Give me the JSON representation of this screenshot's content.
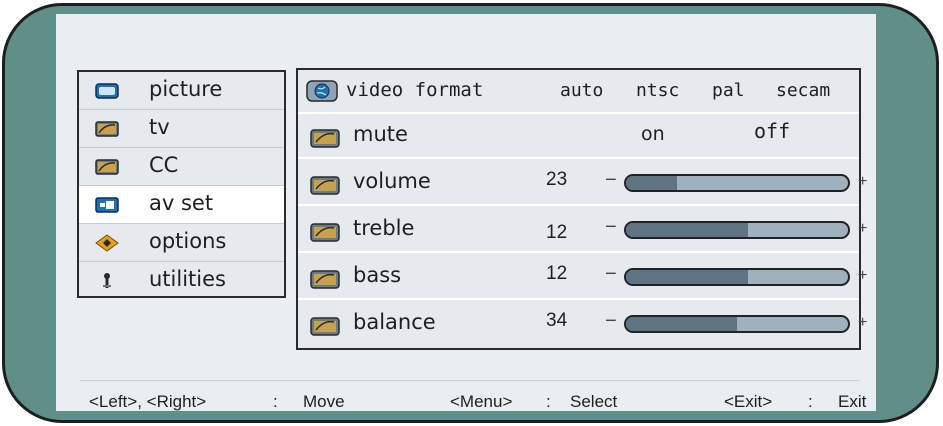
{
  "left_menu": {
    "items": [
      {
        "label": "picture",
        "icon": "picture-icon"
      },
      {
        "label": "tv",
        "icon": "tv-icon"
      },
      {
        "label": "CC",
        "icon": "cc-icon"
      },
      {
        "label": "av set",
        "icon": "av-set-icon"
      },
      {
        "label": "options",
        "icon": "options-icon"
      },
      {
        "label": "utilities",
        "icon": "utilities-icon"
      }
    ],
    "selected": "av set"
  },
  "panel": {
    "video_format": {
      "label": "video format",
      "options": [
        "auto",
        "ntsc",
        "pal",
        "secam"
      ],
      "icon": "globe-icon"
    },
    "mute": {
      "label": "mute",
      "on": "on",
      "off": "off"
    },
    "volume": {
      "label": "volume",
      "value": "23",
      "level": 0.23
    },
    "treble": {
      "label": "treble",
      "value": "12",
      "level": 0.55
    },
    "bass": {
      "label": "bass",
      "value": "12",
      "level": 0.55
    },
    "balance": {
      "label": "balance",
      "value": "34",
      "level": 0.5
    },
    "minus": "−",
    "plus": "+"
  },
  "footer": {
    "move_keys": "<Left>, <Right>",
    "move_sep": ":",
    "move_action": "Move",
    "select_key": "<Menu>",
    "select_sep": ":",
    "select_action": "Select",
    "exit_key": "<Exit>",
    "exit_sep": ":",
    "exit_action": "Exit"
  },
  "colors": {
    "bezel": "#5f8f88",
    "screen": "#e9eef3",
    "slider_fill": "#5f7483",
    "slider_track": "#9fb0bf",
    "icon_folder": "#c8a24a"
  }
}
